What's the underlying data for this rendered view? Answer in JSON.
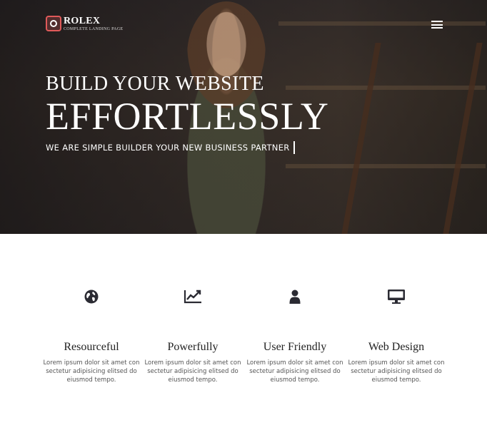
{
  "brand": {
    "name": "ROLEX",
    "tagline": "COMPLETE LANDING PAGE",
    "accent_color": "#e05a5a"
  },
  "nav": {
    "menu_icon": "hamburger-icon"
  },
  "hero": {
    "headline_small": "BUILD YOUR WEBSITE",
    "headline_large": "EFFORTLESSLY",
    "subheadline": "WE ARE SIMPLE BUILDER YOUR NEW BUSINESS PARTNER"
  },
  "features": [
    {
      "icon": "globe-icon",
      "title": "Resourceful",
      "text": "Lorem ipsum dolor sit amet con sectetur adipisicing elitsed do eiusmod tempo."
    },
    {
      "icon": "chart-line-icon",
      "title": "Powerfully",
      "text": "Lorem ipsum dolor sit amet con sectetur adipisicing elitsed do eiusmod tempo."
    },
    {
      "icon": "user-icon",
      "title": "User Friendly",
      "text": "Lorem ipsum dolor sit amet con sectetur adipisicing elitsed do eiusmod tempo."
    },
    {
      "icon": "monitor-icon",
      "title": "Web Design",
      "text": "Lorem ipsum dolor sit amet con sectetur adipisicing elitsed do eiusmod tempo."
    }
  ]
}
